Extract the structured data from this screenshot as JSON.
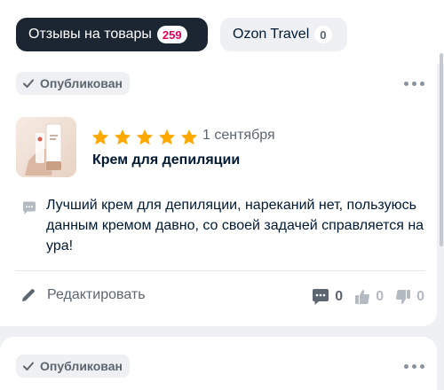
{
  "tabs": [
    {
      "label": "Отзывы на товары",
      "count": "259"
    },
    {
      "label": "Ozon Travel",
      "count": "0"
    }
  ],
  "reviews": [
    {
      "status": "Опубликован",
      "rating": 5,
      "date": "1 сентября",
      "product_name": "Крем для депиляции",
      "text": "Лучший крем для депиляции, нареканий нет, пользуюсь данным кремом давно, со своей задачей справляется на ура!",
      "edit_label": "Редактировать",
      "comments": "0",
      "likes": "0",
      "dislikes": "0"
    },
    {
      "status": "Опубликован"
    }
  ],
  "colors": {
    "star": "#ffa800",
    "badge_accent": "#e6005c",
    "active_tab_bg": "#1c2633"
  }
}
